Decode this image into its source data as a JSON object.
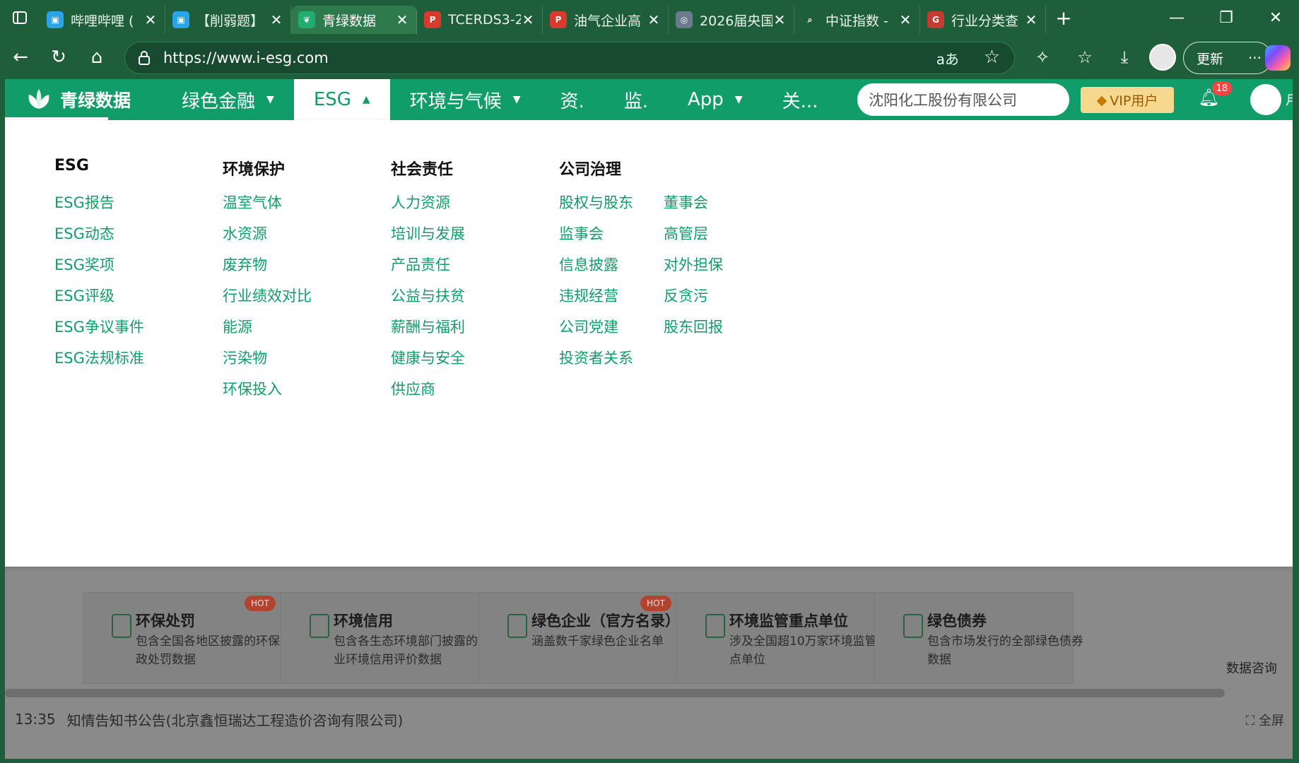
{
  "tabs": [
    {
      "title": "哔哩哔哩 (",
      "favicon": "bilibili-icon",
      "active": false
    },
    {
      "title": "【削弱题】",
      "favicon": "bilibili-icon",
      "active": false
    },
    {
      "title": "青绿数据",
      "favicon": "leaf-icon",
      "active": true
    },
    {
      "title": "TCERDS3-2",
      "favicon": "pdf-icon",
      "active": false
    },
    {
      "title": "油气企业高",
      "favicon": "pdf-icon",
      "active": false
    },
    {
      "title": "2026届央国",
      "favicon": "app-icon",
      "active": false
    },
    {
      "title": "中证指数 -",
      "favicon": "search-icon",
      "active": false
    },
    {
      "title": "行业分类查",
      "favicon": "site-icon",
      "active": false
    }
  ],
  "toolbar": {
    "url": "https://www.i-esg.com",
    "read_aloud_glyph": "aあ",
    "update_label": "更新",
    "more_label": "···"
  },
  "site": {
    "logo_text": "青绿数据",
    "nav": [
      {
        "label": "绿色金融",
        "caret": "▼",
        "active": false
      },
      {
        "label": "ESG",
        "caret": "▲",
        "active": true
      },
      {
        "label": "环境与气候",
        "caret": "▼",
        "active": false
      },
      {
        "label": "资.",
        "caret": "",
        "active": false
      },
      {
        "label": "监.",
        "caret": "",
        "active": false
      },
      {
        "label": "App",
        "caret": "▼",
        "active": false
      },
      {
        "label": "关...",
        "caret": "",
        "active": false
      }
    ],
    "search_value": "沈阳化工股份有限公司",
    "vip_label": "VIP用户",
    "notification_count": "18",
    "edge_char": "月"
  },
  "dropdown": {
    "columns": [
      {
        "heading": "ESG",
        "items": [
          "ESG报告",
          "ESG动态",
          "ESG奖项",
          "ESG评级",
          "ESG争议事件",
          "ESG法规标准"
        ]
      },
      {
        "heading": "环境保护",
        "items": [
          "温室气体",
          "水资源",
          "废弃物",
          "行业绩效对比",
          "能源",
          "污染物",
          "环保投入"
        ]
      },
      {
        "heading": "社会责任",
        "items": [
          "人力资源",
          "培训与发展",
          "产品责任",
          "公益与扶贫",
          "薪酬与福利",
          "健康与安全",
          "供应商"
        ]
      },
      {
        "heading": "公司治理",
        "items": [
          "股权与股东",
          "监事会",
          "信息披露",
          "违规经营",
          "公司党建",
          "投资者关系"
        ]
      },
      {
        "heading": "",
        "items": [
          "董事会",
          "高管层",
          "对外担保",
          "反贪污",
          "股东回报"
        ]
      }
    ]
  },
  "cards": [
    {
      "title": "环保处罚",
      "desc": "包含全国各地区披露的环保行政处罚数据",
      "hot": true
    },
    {
      "title": "环境信用",
      "desc": "包含各生态环境部门披露的企业环境信用评价数据",
      "hot": false
    },
    {
      "title": "绿色企业（官方名录）",
      "desc": "涵盖数千家绿色企业名单",
      "hot": true
    },
    {
      "title": "环境监管重点单位",
      "desc": "涉及全国超10万家环境监管重点单位",
      "hot": false
    },
    {
      "title": "绿色债券",
      "desc": "包含市场发行的全部绿色债券数据",
      "hot": false
    }
  ],
  "hot_label": "HOT",
  "consult_label": "数据咨询",
  "ticker": {
    "time": "13:35",
    "text": "知情告知书公告(北京鑫恒瑞达工程造价咨询有限公司)"
  },
  "fullscreen_label": "⛶ 全屏",
  "colors": {
    "brand": "#119d6a",
    "browser_chrome": "#1f5e3a",
    "vip": "#f7d88f",
    "hot": "#b2432e"
  }
}
